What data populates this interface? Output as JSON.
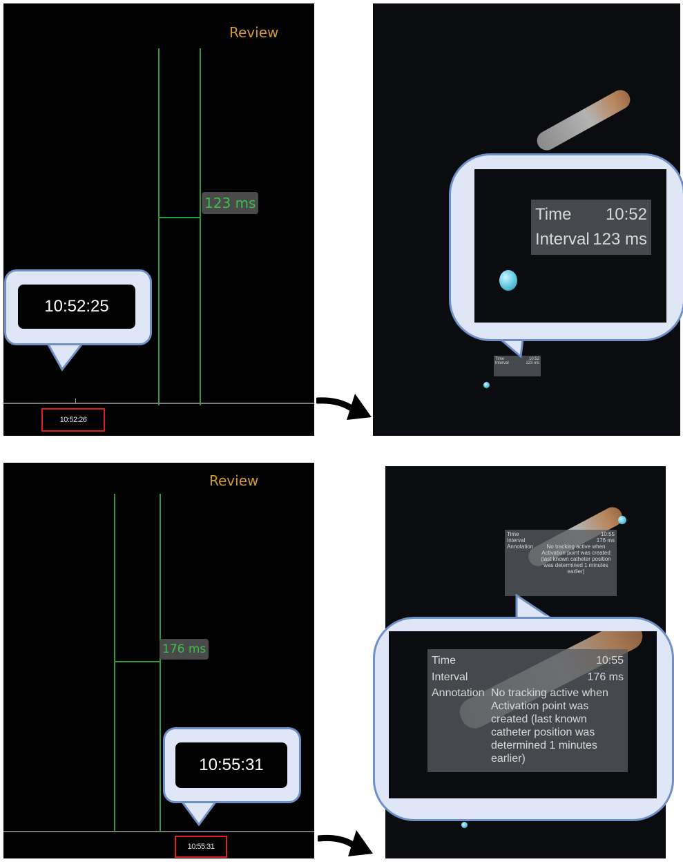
{
  "panels": {
    "top_left": {
      "review_label": "Review",
      "interval_label": "123 ms",
      "callout_time": "10:52:25",
      "axis_time": "10:52:26"
    },
    "top_right": {
      "time_label": "Time",
      "time_value": "10:52",
      "interval_label": "Interval",
      "interval_value": "123 ms"
    },
    "bottom_left": {
      "review_label": "Review",
      "interval_label": "176 ms",
      "callout_time": "10:55:31",
      "axis_time": "10:55:31"
    },
    "bottom_right": {
      "time_label": "Time",
      "time_value": "10:55",
      "interval_label": "Interval",
      "interval_value": "176 ms",
      "annotation_label": "Annotation",
      "annotation_text": "No tracking active when Activation point was created (last known catheter position was determined 1 minutes earlier)"
    }
  },
  "colors": {
    "review": "#d29a2a",
    "grid_line": "#2f9a3a",
    "highlight_box": "#e02020",
    "callout_fill": "#dfe7f6",
    "callout_border": "#6f8fc7"
  },
  "icons": [
    "curved-arrow-icon",
    "catheter-rod",
    "activation-point-sphere"
  ]
}
